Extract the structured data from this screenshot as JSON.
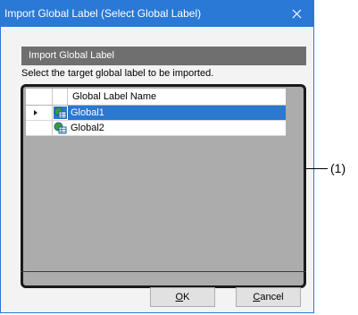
{
  "window": {
    "title": "Import Global Label (Select Global Label)"
  },
  "section": {
    "header": "Import Global Label",
    "instruction": "Select the target global label to be imported."
  },
  "grid": {
    "column_header": "Global Label Name",
    "rows": [
      {
        "name": "Global1",
        "selected": true
      },
      {
        "name": "Global2",
        "selected": false
      }
    ]
  },
  "buttons": {
    "ok_label": "OK",
    "ok_mnemonic": "O",
    "ok_rest": "K",
    "cancel_label": "Cancel",
    "cancel_mnemonic": "C",
    "cancel_rest": "ancel"
  },
  "annotation": {
    "callout_label": "(1)"
  },
  "colors": {
    "titlebar": "#2b79d6",
    "selection": "#2a78d0",
    "grid_background": "#acacac",
    "section_header": "#6f6f6f"
  },
  "icons": {
    "close": "close-icon",
    "row_pointer": "row-pointer-icon",
    "global_label": "global-label-icon"
  }
}
